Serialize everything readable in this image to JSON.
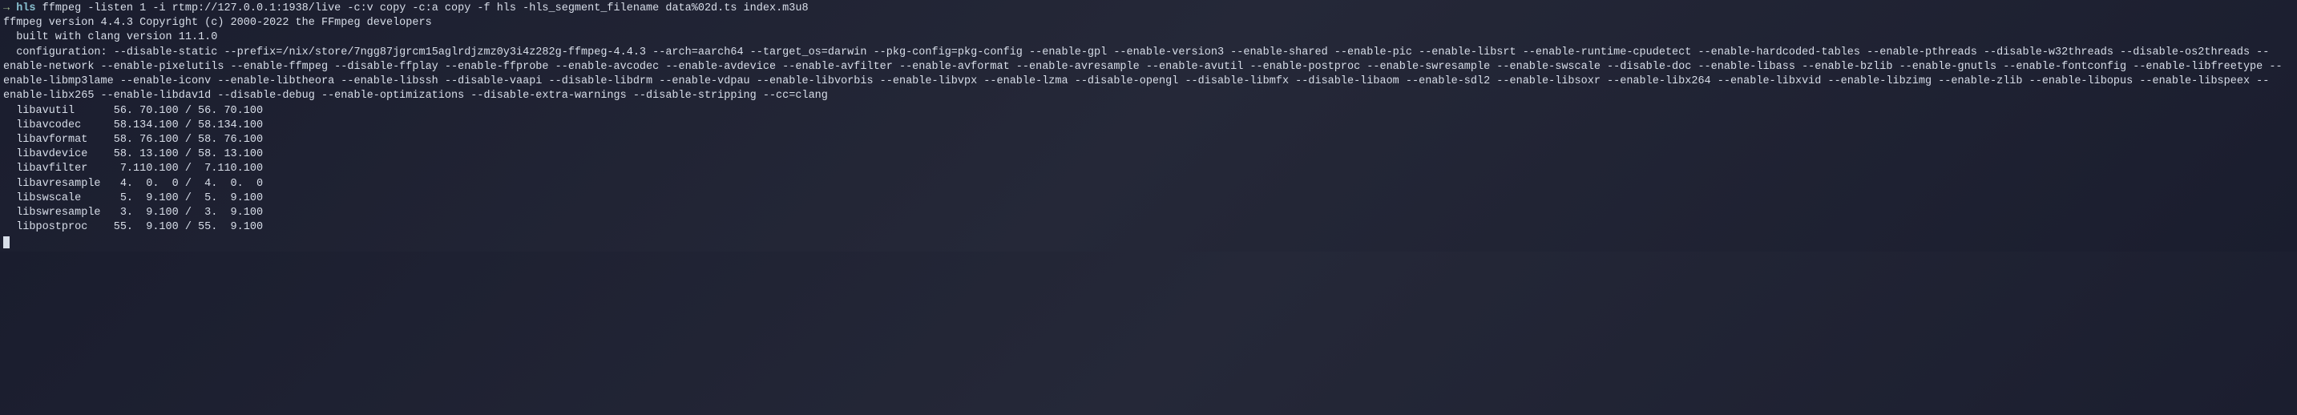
{
  "prompt": {
    "arrow": "→ ",
    "dir": "hls",
    "command": " ffmpeg -listen 1 -i rtmp://127.0.0.1:1938/live -c:v copy -c:a copy -f hls -hls_segment_filename data%02d.ts index.m3u8"
  },
  "output": {
    "version_line": "ffmpeg version 4.4.3 Copyright (c) 2000-2022 the FFmpeg developers",
    "built_line": "  built with clang version 11.1.0",
    "config_line": "  configuration: --disable-static --prefix=/nix/store/7ngg87jgrcm15aglrdjzmz0y3i4z282g-ffmpeg-4.4.3 --arch=aarch64 --target_os=darwin --pkg-config=pkg-config --enable-gpl --enable-version3 --enable-shared --enable-pic --enable-libsrt --enable-runtime-cpudetect --enable-hardcoded-tables --enable-pthreads --disable-w32threads --disable-os2threads --enable-network --enable-pixelutils --enable-ffmpeg --disable-ffplay --enable-ffprobe --enable-avcodec --enable-avdevice --enable-avfilter --enable-avformat --enable-avresample --enable-avutil --enable-postproc --enable-swresample --enable-swscale --disable-doc --enable-libass --enable-bzlib --enable-gnutls --enable-fontconfig --enable-libfreetype --enable-libmp3lame --enable-iconv --enable-libtheora --enable-libssh --disable-vaapi --disable-libdrm --enable-vdpau --enable-libvorbis --enable-libvpx --enable-lzma --disable-opengl --disable-libmfx --disable-libaom --enable-sdl2 --enable-libsoxr --enable-libx264 --enable-libxvid --enable-libzimg --enable-zlib --enable-libopus --enable-libspeex --enable-libx265 --enable-libdav1d --disable-debug --enable-optimizations --disable-extra-warnings --disable-stripping --cc=clang",
    "libs": [
      "  libavutil      56. 70.100 / 56. 70.100",
      "  libavcodec     58.134.100 / 58.134.100",
      "  libavformat    58. 76.100 / 58. 76.100",
      "  libavdevice    58. 13.100 / 58. 13.100",
      "  libavfilter     7.110.100 /  7.110.100",
      "  libavresample   4.  0.  0 /  4.  0.  0",
      "  libswscale      5.  9.100 /  5.  9.100",
      "  libswresample   3.  9.100 /  3.  9.100",
      "  libpostproc    55.  9.100 / 55.  9.100"
    ]
  }
}
